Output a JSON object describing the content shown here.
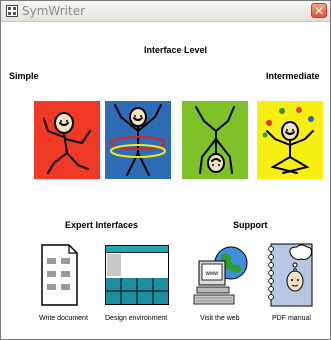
{
  "window": {
    "title": "SymWriter",
    "close_glyph": "✕"
  },
  "headings": {
    "interface_level": "Interface Level",
    "simple": "Simple",
    "intermediate": "Intermediate",
    "expert": "Expert Interfaces",
    "support": "Support"
  },
  "tiles": [
    {
      "icon": "dancing-figure-icon",
      "bg": "#f03a26"
    },
    {
      "icon": "hula-hoop-figure-icon",
      "bg": "#2e6cb6"
    },
    {
      "icon": "handstand-figure-icon",
      "bg": "#7ec12a"
    },
    {
      "icon": "juggling-figure-icon",
      "bg": "#f7ef12"
    }
  ],
  "expert_items": [
    {
      "label": "Write document",
      "icon": "document-icon"
    },
    {
      "label": "Design environment",
      "icon": "grid-layout-icon"
    }
  ],
  "support_items": [
    {
      "label": "Visit the web",
      "icon": "web-computer-icon"
    },
    {
      "label": "PDF manual",
      "icon": "manual-icon"
    }
  ]
}
